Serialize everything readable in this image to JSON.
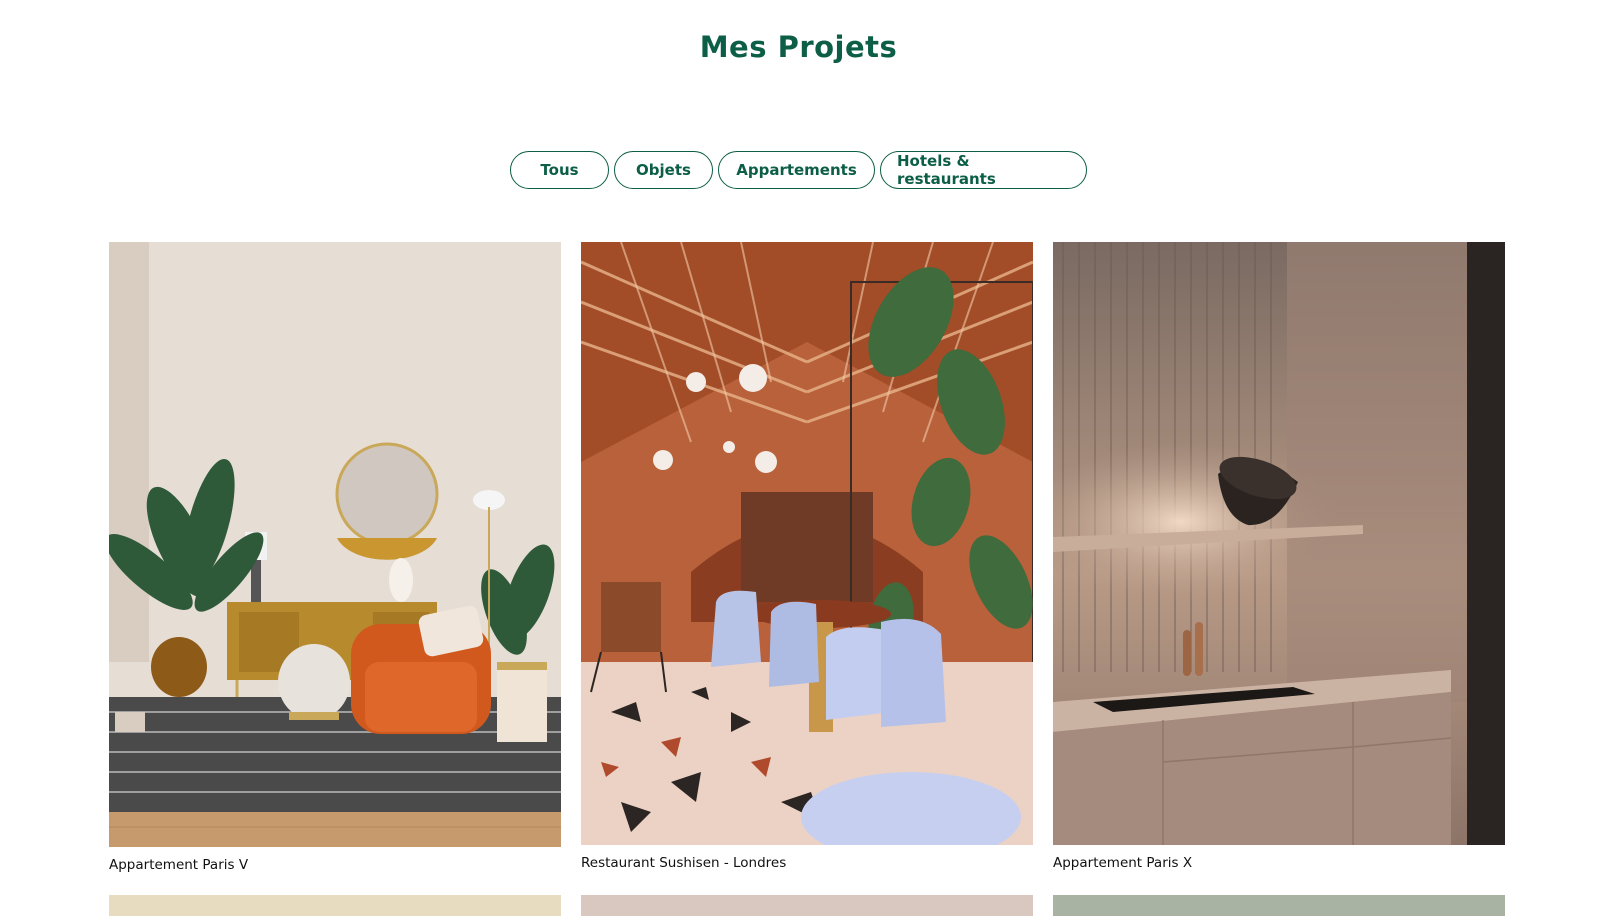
{
  "page": {
    "title": "Mes Projets"
  },
  "filters": [
    {
      "label": "Tous"
    },
    {
      "label": "Objets"
    },
    {
      "label": "Appartements"
    },
    {
      "label": "Hotels & restaurants"
    }
  ],
  "projects": [
    {
      "caption": "Appartement Paris V",
      "image": "living-room-photo"
    },
    {
      "caption": "Restaurant Sushisen - Londres",
      "image": "restaurant-photo"
    },
    {
      "caption": "Appartement Paris X",
      "image": "kitchen-photo"
    }
  ],
  "colors": {
    "accent": "#0c5e47",
    "text": "#111111",
    "background": "#ffffff"
  }
}
